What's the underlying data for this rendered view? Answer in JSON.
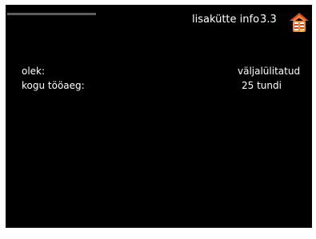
{
  "header": {
    "title": "lisakütte info",
    "menu_number": "3.3",
    "icon": "auxiliary-heater-icon",
    "accent_color": "#d94b1f"
  },
  "info": {
    "status_label": "olek:",
    "status_value": "väljalülitatud",
    "runtime_label": "kogu tööaeg:",
    "runtime_value": "25 tundi"
  }
}
